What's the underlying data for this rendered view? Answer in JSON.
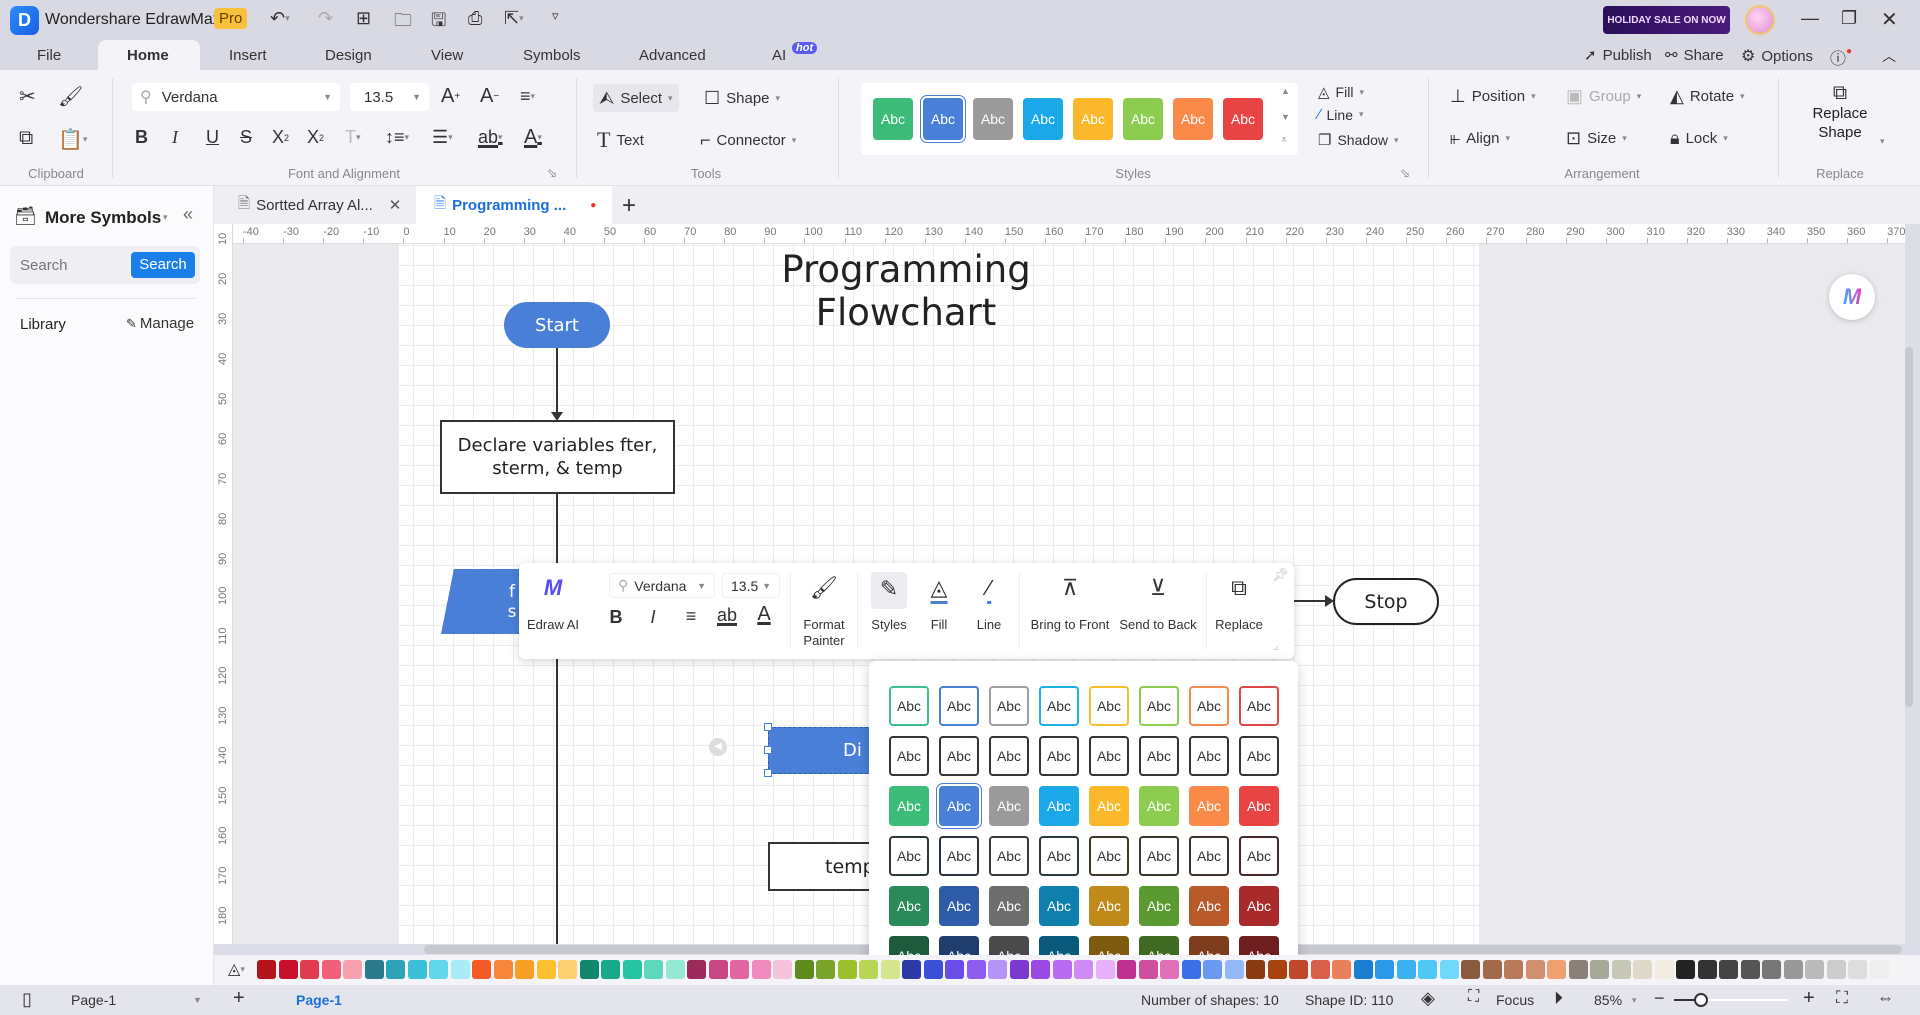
{
  "app": {
    "title": "Wondershare EdrawMax",
    "badge": "Pro",
    "promo": "HOLIDAY SALE ON NOW"
  },
  "menu": {
    "tabs": [
      "File",
      "Home",
      "Insert",
      "Design",
      "View",
      "Symbols",
      "Advanced",
      "AI"
    ],
    "hot": "hot",
    "active": "Home",
    "publish": "Publish",
    "share": "Share",
    "options": "Options"
  },
  "ribbon": {
    "font": "Verdana",
    "size": "13.5",
    "select": "Select",
    "shape": "Shape",
    "text": "Text",
    "connector": "Connector",
    "fill": "Fill",
    "line": "Line",
    "shadow": "Shadow",
    "position": "Position",
    "group": "Group",
    "rotate": "Rotate",
    "align": "Align",
    "size_btn": "Size",
    "lock": "Lock",
    "replace_1": "Replace",
    "replace_2": "Shape",
    "groups": {
      "clipboard": "Clipboard",
      "font": "Font and Alignment",
      "tools": "Tools",
      "styles": "Styles",
      "arrangement": "Arrangement",
      "replace": "Replace"
    },
    "style_label": "Abc",
    "style_colors": [
      "#3dbb78",
      "#4a7fd8",
      "#9a9a9a",
      "#1aa8e8",
      "#fbb82a",
      "#8ccc50",
      "#f98a4a",
      "#e84444"
    ],
    "style_selected": 1
  },
  "sidebar": {
    "title": "More Symbols",
    "search_placeholder": "Search",
    "search_button": "Search",
    "library": "Library",
    "manage": "Manage"
  },
  "doc_tabs": [
    {
      "label": "Sortted Array Al..."
    },
    {
      "label": "Programming ...",
      "active": true,
      "unsaved": true
    }
  ],
  "ruler": {
    "h": [
      "-40",
      "-30",
      "-20",
      "-10",
      "0",
      "10",
      "20",
      "30",
      "40",
      "50",
      "60",
      "70",
      "80",
      "90",
      "100",
      "110",
      "120",
      "130",
      "140",
      "150",
      "160",
      "170",
      "180",
      "190",
      "200",
      "210",
      "220",
      "230",
      "240",
      "250",
      "260",
      "270",
      "280",
      "290",
      "300",
      "310",
      "320",
      "330",
      "340",
      "350",
      "360",
      "370"
    ],
    "v": [
      "10",
      "20",
      "30",
      "40",
      "50",
      "60",
      "70",
      "80",
      "90",
      "100",
      "110",
      "120",
      "130",
      "140",
      "150",
      "160",
      "170",
      "180"
    ]
  },
  "diagram": {
    "title": "Programming Flowchart",
    "start": "Start",
    "declare": "Declare variables fter, sterm, & temp",
    "para_1": "f",
    "para_2": "s",
    "selected": "Di",
    "temp": "temp",
    "stop": "Stop"
  },
  "floatbar": {
    "edraw_ai": "Edraw AI",
    "font": "Verdana",
    "size": "13.5",
    "format_painter_1": "Format",
    "format_painter_2": "Painter",
    "styles": "Styles",
    "fill": "Fill",
    "line": "Line",
    "bring_front": "Bring to Front",
    "send_back": "Send to Back",
    "replace": "Replace"
  },
  "style_popup": {
    "label": "Abc",
    "selected": [
      2,
      1
    ],
    "rows": [
      {
        "kind": "outline",
        "colors": [
          "#3fbf8f",
          "#4a7fd8",
          "#a0a0a0",
          "#1ab0e8",
          "#f5c030",
          "#8ccc50",
          "#f58a50",
          "#e04848"
        ]
      },
      {
        "kind": "dark",
        "colors": [
          "#333333",
          "#333333",
          "#333333",
          "#333333",
          "#333333",
          "#333333",
          "#333333",
          "#333333"
        ]
      },
      {
        "kind": "fill",
        "colors": [
          "#3dbb78",
          "#4a7fd8",
          "#9a9a9a",
          "#1aa8e8",
          "#fbb82a",
          "#8ccc50",
          "#f98a4a",
          "#e84444"
        ]
      },
      {
        "kind": "dark",
        "colors": [
          "#2a3a32",
          "#2a3242",
          "#3a3a3a",
          "#2a3a42",
          "#42392a",
          "#323a2a",
          "#3f322a",
          "#422a2a"
        ]
      },
      {
        "kind": "fill",
        "colors": [
          "#2a8a5a",
          "#2f5ca8",
          "#6e6e6e",
          "#0f7fae",
          "#c08a1a",
          "#5a9a30",
          "#b85a2a",
          "#a82a2a"
        ]
      },
      {
        "kind": "fill",
        "colors": [
          "#1e5a3c",
          "#1f3e6e",
          "#4a4a4a",
          "#0a5a7e",
          "#7e5a0e",
          "#3e6a22",
          "#7e3e1e",
          "#6e1e1e"
        ]
      }
    ]
  },
  "palette": [
    "#b5121b",
    "#c8102e",
    "#e03c4f",
    "#f0607a",
    "#f7a0b0",
    "#2a7a8c",
    "#2ea3b8",
    "#3cc0d8",
    "#62d6ea",
    "#a8ecf5",
    "#f45a25",
    "#f7863a",
    "#f8a024",
    "#fbc02d",
    "#fcd070",
    "#13876e",
    "#17a98a",
    "#25c4a3",
    "#5ed8bd",
    "#95e8d4",
    "#9c2a5a",
    "#c94584",
    "#e066a2",
    "#f089bd",
    "#f6c3dc",
    "#5f8a1c",
    "#7aa52a",
    "#9cbf2c",
    "#b9d556",
    "#d6e68e",
    "#2d3aa5",
    "#3c4fd8",
    "#6a4ce8",
    "#8e5cf0",
    "#b594f5",
    "#7a3ad0",
    "#9a4ae0",
    "#b86af0",
    "#d08af5",
    "#e8b0f8",
    "#c03090",
    "#d050a0",
    "#e070b8",
    "#3a6fe8",
    "#6b98f0",
    "#93b8f5",
    "#8a3a10",
    "#a8420f",
    "#c0482a",
    "#d8604a",
    "#e8805c",
    "#1a7fd0",
    "#2a9ae8",
    "#3cb0f0",
    "#50c8f5",
    "#70d8f8",
    "#8a5a40",
    "#a06a4a",
    "#b87a5a",
    "#d09070",
    "#f0a070",
    "#8a8078",
    "#a8a898",
    "#c8c8b8",
    "#e0d8c8",
    "#f0ece0",
    "#222222",
    "#333333",
    "#444444",
    "#555555",
    "#777777",
    "#999999",
    "#bbbbbb",
    "#cccccc",
    "#dddddd",
    "#eeeeee",
    "#f5f5f5"
  ],
  "status": {
    "page_select": "Page-1",
    "page_tab": "Page-1",
    "shapes": "Number of shapes: 10",
    "shape_id": "Shape ID: 110",
    "focus": "Focus",
    "zoom": "85%",
    "zoom_level": 85
  },
  "colors": {
    "accent": "#1a7fe8",
    "shape_blue": "#4a7fd8"
  }
}
